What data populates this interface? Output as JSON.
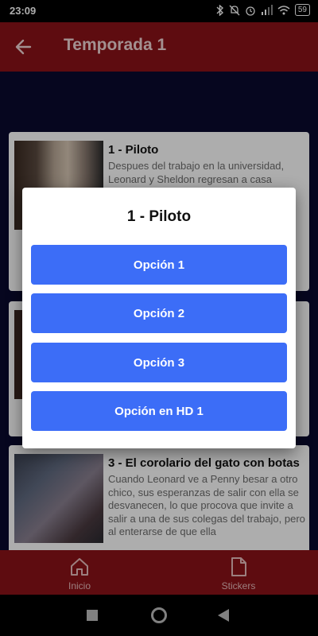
{
  "status_bar": {
    "time": "23:09",
    "battery": "59"
  },
  "app_bar": {
    "title": "Temporada 1"
  },
  "episodes": [
    {
      "title": "1 - Piloto",
      "description": "Despues del trabajo en la universidad, Leonard y Sheldon regresan a casa"
    },
    {
      "title": "",
      "description": ""
    },
    {
      "title": "3 - El corolario del gato con botas",
      "description": "Cuando Leonard ve a Penny besar a otro chico, sus esperanzas de salir con ella se desvanecen, lo que procova que invite a salir a una de sus colegas del trabajo, pero al enterarse de que ella"
    }
  ],
  "dialog": {
    "title": "1 - Piloto",
    "options": [
      "Opción 1",
      "Opción 2",
      "Opción 3",
      "Opción en HD 1"
    ]
  },
  "bottom_nav": {
    "items": [
      {
        "label": "Inicio",
        "icon": "home-icon"
      },
      {
        "label": "Stickers",
        "icon": "file-icon"
      }
    ]
  },
  "colors": {
    "primary": "#8b1218",
    "accent": "#3c6df7",
    "background": "#0a0a2e"
  }
}
